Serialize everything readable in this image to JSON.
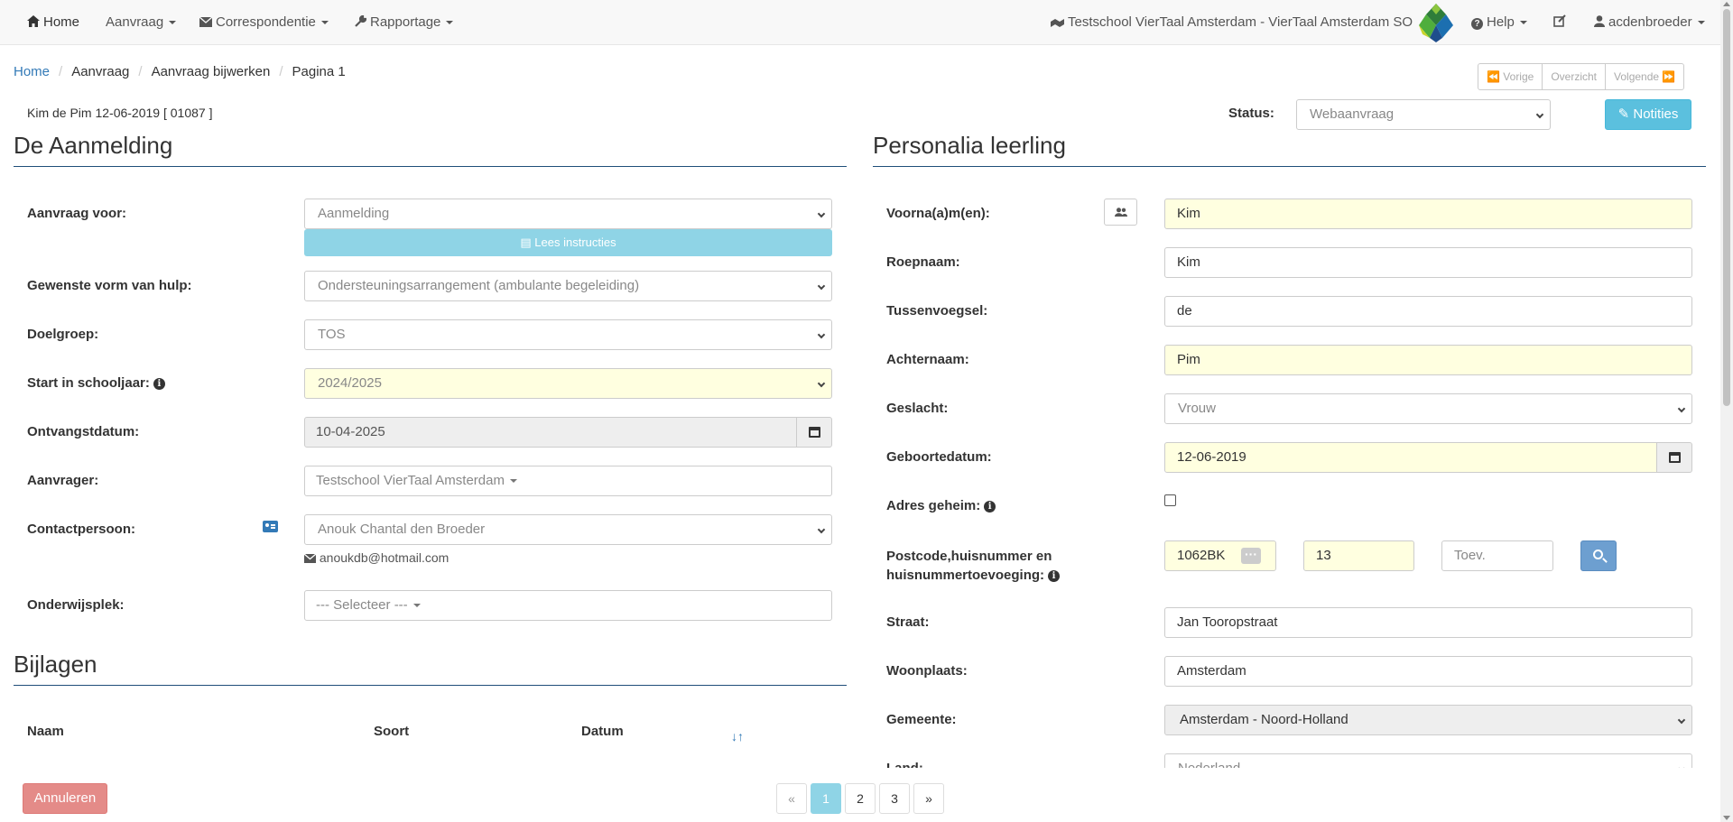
{
  "nav": {
    "home": "Home",
    "aanvraag": "Aanvraag",
    "correspondentie": "Correspondentie",
    "rapportage": "Rapportage",
    "school": "Testschool VierTaal Amsterdam - VierTaal Amsterdam SO",
    "help": "Help",
    "user": "acdenbroeder"
  },
  "breadcrumb": {
    "items": [
      "Home",
      "Aanvraag",
      "Aanvraag bijwerken",
      "Pagina 1"
    ]
  },
  "pager_top": {
    "prev": "Vorige",
    "overview": "Overzicht",
    "next": "Volgende"
  },
  "student_id": "Kim de Pim 12-06-2019  [ 01087 ]",
  "status": {
    "label": "Status:",
    "value": "Webaanvraag"
  },
  "notities": "Notities",
  "aanmelding": {
    "title": "De Aanmelding",
    "fields": {
      "aanvraag_voor": {
        "label": "Aanvraag voor:",
        "value": "Aanmelding"
      },
      "instructies": "Lees instructies",
      "vorm_hulp": {
        "label": "Gewenste vorm van hulp:",
        "value": "Ondersteuningsarrangement (ambulante begeleiding)"
      },
      "doelgroep": {
        "label": "Doelgroep:",
        "value": "TOS"
      },
      "start": {
        "label": "Start in schooljaar:",
        "value": "2024/2025"
      },
      "ontvangst": {
        "label": "Ontvangstdatum:",
        "value": "10-04-2025"
      },
      "aanvrager": {
        "label": "Aanvrager:",
        "value": "Testschool VierTaal Amsterdam"
      },
      "contact": {
        "label": "Contactpersoon:",
        "value": "Anouk Chantal den Broeder",
        "email": "anoukdb@hotmail.com"
      },
      "onderwijsplek": {
        "label": "Onderwijsplek:",
        "value": "--- Selecteer ---"
      }
    }
  },
  "bijlagen": {
    "title": "Bijlagen",
    "columns": [
      "Naam",
      "Soort",
      "Datum"
    ]
  },
  "personalia": {
    "title": "Personalia leerling",
    "fields": {
      "voornamen": {
        "label": "Voorna(a)m(en):",
        "value": "Kim"
      },
      "roepnaam": {
        "label": "Roepnaam:",
        "value": "Kim"
      },
      "tussenvoegsel": {
        "label": "Tussenvoegsel:",
        "value": "de"
      },
      "achternaam": {
        "label": "Achternaam:",
        "value": "Pim"
      },
      "geslacht": {
        "label": "Geslacht:",
        "value": "Vrouw"
      },
      "geboortedatum": {
        "label": "Geboortedatum:",
        "value": "12-06-2019"
      },
      "adres_geheim": {
        "label": "Adres geheim:"
      },
      "postcode": {
        "label_line1": "Postcode,huisnummer en",
        "label_line2": "huisnummertoevoeging:",
        "postcode": "1062BK",
        "huisnummer": "13",
        "toevoeging_placeholder": "Toev."
      },
      "straat": {
        "label": "Straat:",
        "value": "Jan Tooropstraat"
      },
      "woonplaats": {
        "label": "Woonplaats:",
        "value": "Amsterdam"
      },
      "gemeente": {
        "label": "Gemeente:",
        "value": "Amsterdam - Noord-Holland"
      },
      "land": {
        "label": "Land:",
        "value": "Nederland"
      }
    }
  },
  "footer": {
    "annuleren": "Annuleren",
    "pages": [
      "«",
      "1",
      "2",
      "3",
      "»"
    ],
    "active_page": "1"
  },
  "icons": {
    "home": "home-icon",
    "envelope": "envelope-icon",
    "wrench": "wrench-icon",
    "school": "school-icon",
    "help": "question-icon",
    "edit": "edit-icon",
    "user": "user-icon",
    "calendar": "calendar-icon",
    "search": "search-icon",
    "sort": "sort-icon"
  },
  "colors": {
    "accent_info": "#5bc0de",
    "danger_light": "#e48b88",
    "required_field": "#ffffe0",
    "link": "#337ab7"
  }
}
